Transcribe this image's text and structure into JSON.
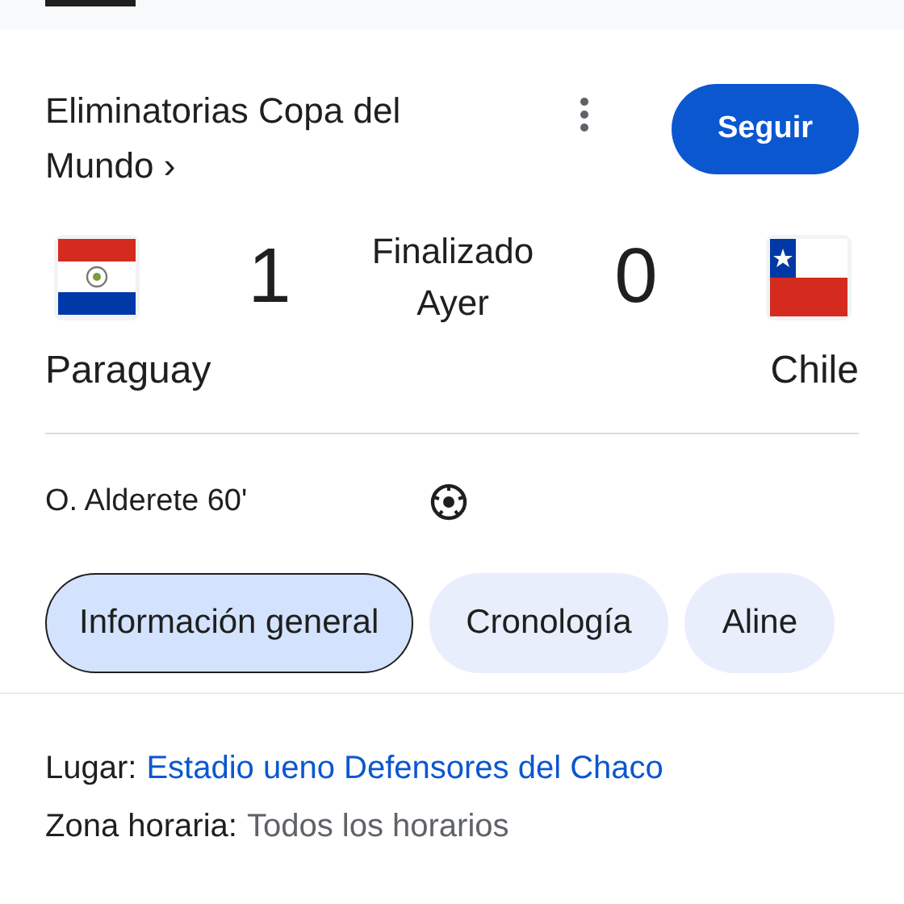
{
  "competition": {
    "title": "Eliminatorias Copa del Mundo ›",
    "follow_button": "Seguir"
  },
  "match": {
    "home": {
      "name": "Paraguay",
      "score": "1"
    },
    "away": {
      "name": "Chile",
      "score": "0"
    },
    "status": "Finalizado",
    "date": "Ayer"
  },
  "goals": [
    {
      "scorer": "O. Alderete 60'"
    }
  ],
  "tabs": [
    {
      "label": "Información general",
      "selected": true
    },
    {
      "label": "Cronología",
      "selected": false
    },
    {
      "label": "Aline",
      "selected": false
    }
  ],
  "info": [
    {
      "label": "Lugar:",
      "value": "Estadio ueno Defensores del Chaco",
      "kind": "link"
    },
    {
      "label": "Zona horaria:",
      "value": "Todos los horarios",
      "kind": "text"
    }
  ]
}
